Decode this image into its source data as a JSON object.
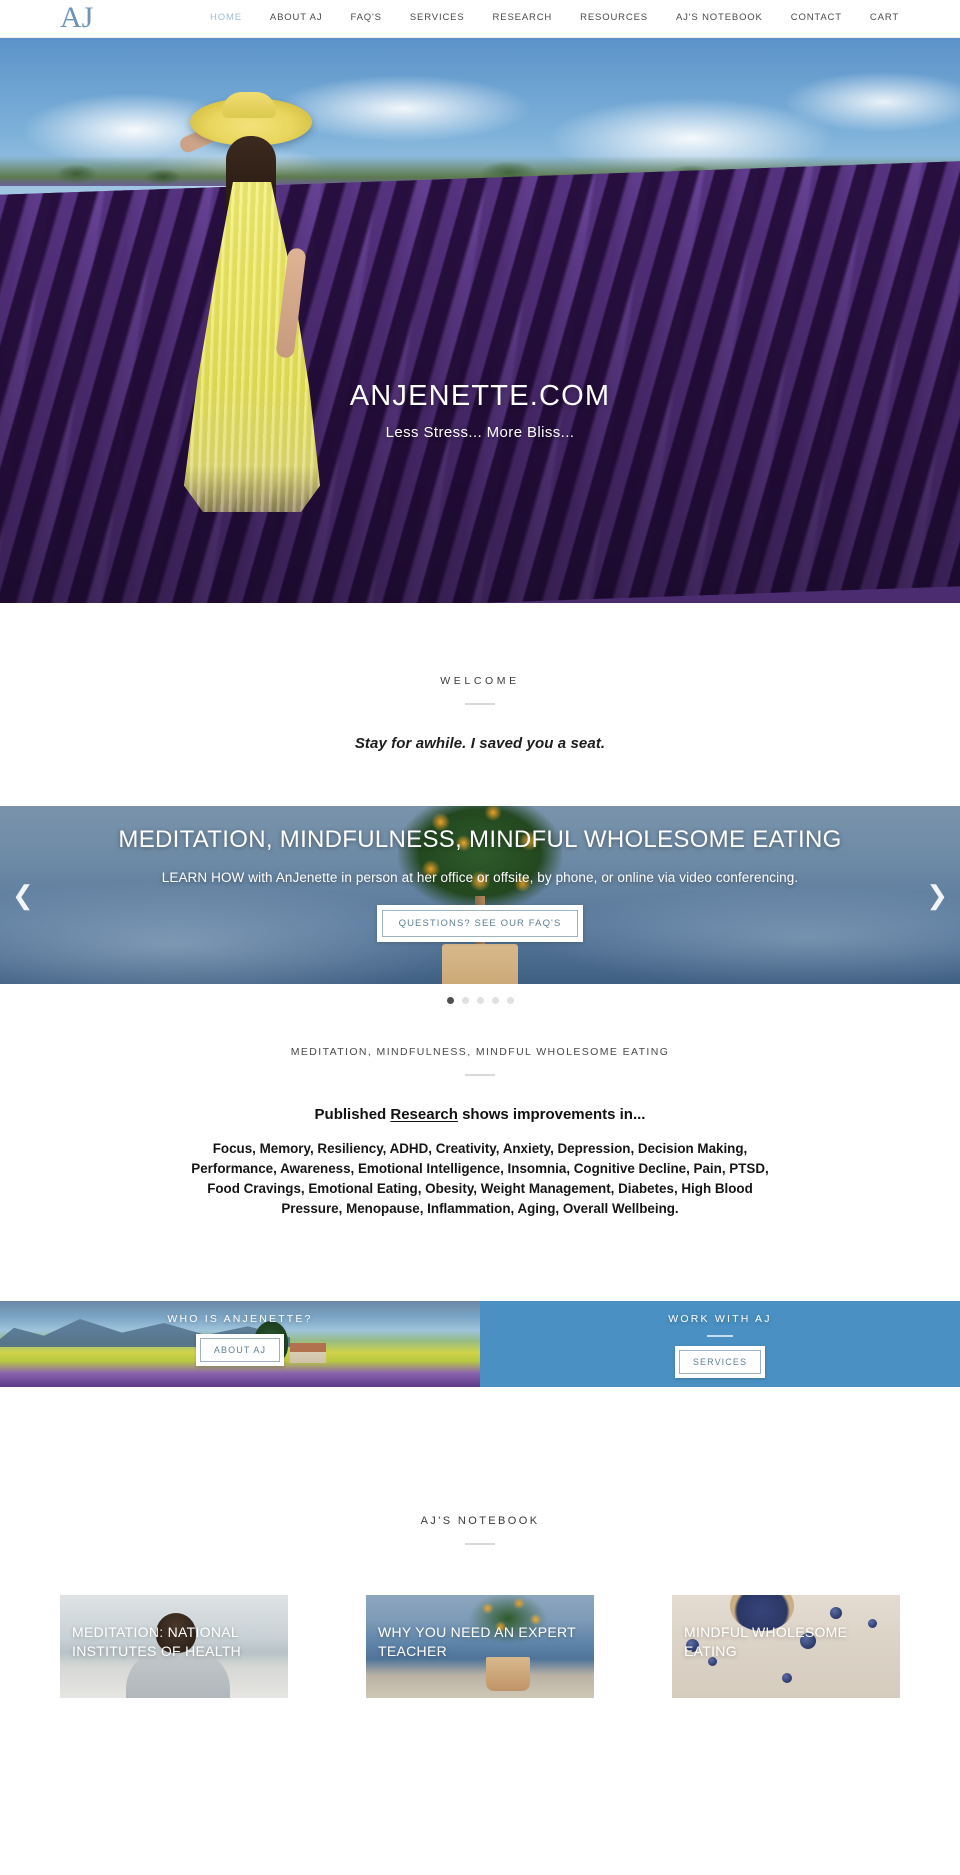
{
  "header": {
    "logo": "AJ",
    "nav": [
      {
        "label": "HOME",
        "active": true
      },
      {
        "label": "ABOUT AJ",
        "active": false
      },
      {
        "label": "FAQ'S",
        "active": false
      },
      {
        "label": "SERVICES",
        "active": false
      },
      {
        "label": "RESEARCH",
        "active": false
      },
      {
        "label": "RESOURCES",
        "active": false
      },
      {
        "label": "AJ'S NOTEBOOK",
        "active": false
      },
      {
        "label": "CONTACT",
        "active": false
      },
      {
        "label": "CART",
        "active": false
      }
    ],
    "active_color": "#9dbdd4",
    "logo_color": "#6e93b5"
  },
  "hero": {
    "title": "ANJENETTE.COM",
    "subtitle": "Less Stress... More Bliss...",
    "scroll_icon": "chevron-down-icon"
  },
  "welcome": {
    "eyebrow": "WELCOME",
    "headline": "Stay for awhile. I saved you a seat."
  },
  "slider": {
    "title": "MEDITATION, MINDFULNESS, MINDFUL WHOLESOME EATING",
    "subtitle": "LEARN HOW with AnJenette in person at her office or offsite, by phone, or online via video conferencing.",
    "button": "QUESTIONS? SEE OUR FAQ'S",
    "prev_icon": "chevron-left-icon",
    "next_icon": "chevron-right-icon",
    "dots": [
      {
        "active": true
      },
      {
        "active": false
      },
      {
        "active": false
      },
      {
        "active": false
      },
      {
        "active": false
      }
    ],
    "active_dot_color": "#4e4e4e",
    "inactive_dot_color": "#e0e0e0"
  },
  "research": {
    "eyebrow": "MEDITATION, MINDFULNESS, MINDFUL WHOLESOME EATING",
    "headline_before": "Published ",
    "headline_underlined": "Research",
    "headline_after": " shows improvements in...",
    "body": "Focus, Memory, Resiliency, ADHD, Creativity, Anxiety, Depression, Decision Making, Performance, Awareness, Emotional Intelligence, Insomnia, Cognitive Decline, Pain, PTSD, Food Cravings, Emotional Eating, Obesity, Weight Management, Diabetes, High Blood Pressure, Menopause, Inflammation, Aging, Overall Wellbeing."
  },
  "panels": {
    "left": {
      "title": "WHO IS ANJENETTE?",
      "button": "ABOUT AJ"
    },
    "right": {
      "title": "WORK WITH AJ",
      "button": "SERVICES",
      "background_color": "#4a90c2"
    }
  },
  "notebook": {
    "eyebrow": "AJ'S NOTEBOOK",
    "cards": [
      {
        "title": "MEDITATION: NATIONAL INSTITUTES OF HEALTH"
      },
      {
        "title": "WHY YOU NEED AN EXPERT TEACHER"
      },
      {
        "title": "MINDFUL WHOLESOME EATING"
      }
    ]
  }
}
